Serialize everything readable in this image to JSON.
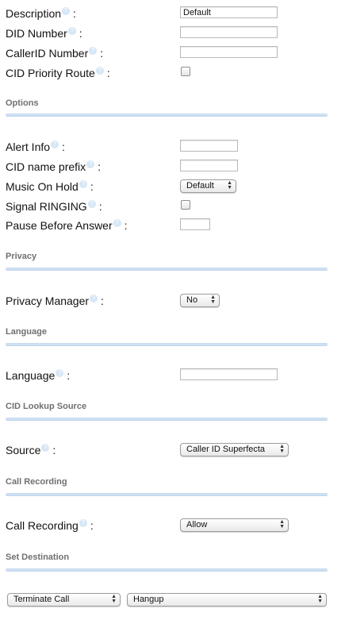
{
  "fields": {
    "description": {
      "label": "Description",
      "value": "Default"
    },
    "did_number": {
      "label": "DID Number",
      "value": ""
    },
    "callerid_number": {
      "label": "CallerID Number",
      "value": ""
    },
    "cid_priority_route": {
      "label": "CID Priority Route",
      "checked": false
    }
  },
  "options": {
    "title": "Options",
    "alert_info": {
      "label": "Alert Info",
      "value": ""
    },
    "cid_name_prefix": {
      "label": "CID name prefix",
      "value": ""
    },
    "music_on_hold": {
      "label": "Music On Hold",
      "selected": "Default"
    },
    "signal_ringing": {
      "label": "Signal RINGING",
      "checked": false
    },
    "pause_before_answer": {
      "label": "Pause Before Answer",
      "value": ""
    }
  },
  "privacy": {
    "title": "Privacy",
    "privacy_manager": {
      "label": "Privacy Manager",
      "selected": "No"
    }
  },
  "language": {
    "title": "Language",
    "language": {
      "label": "Language",
      "value": ""
    }
  },
  "cid_lookup": {
    "title": "CID Lookup Source",
    "source": {
      "label": "Source",
      "selected": "Caller ID Superfecta"
    }
  },
  "call_recording": {
    "title": "Call Recording",
    "recording": {
      "label": "Call Recording",
      "selected": "Allow"
    }
  },
  "destination": {
    "title": "Set Destination",
    "type_selected": "Terminate Call",
    "target_selected": "Hangup"
  },
  "help_glyph": "?",
  "colon": ":",
  "select_arrows": "▲▼"
}
